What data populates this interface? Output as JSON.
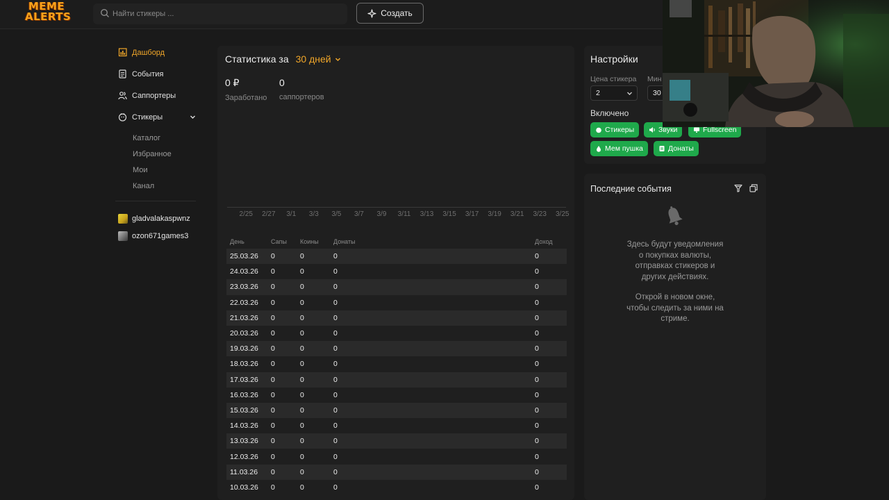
{
  "brand": {
    "logo_line1": "MEME",
    "logo_line2": "ALERTS",
    "logo_color": "#f7a21b"
  },
  "search": {
    "placeholder": "Найти стикеры ..."
  },
  "header": {
    "create_label": "Создать"
  },
  "accent": "#f0a629",
  "toggle_color": "#1fa94b",
  "sidebar": {
    "items": [
      {
        "label": "Дашборд",
        "icon": "bar-chart-icon",
        "active": true
      },
      {
        "label": "События",
        "icon": "document-icon"
      },
      {
        "label": "Саппортеры",
        "icon": "users-icon"
      },
      {
        "label": "Стикеры",
        "icon": "sticker-icon",
        "expanded": true
      }
    ],
    "sub_items": [
      "Каталог",
      "Избранное",
      "Мои",
      "Канал"
    ],
    "channels": [
      {
        "name": "gladvalakaspwnz"
      },
      {
        "name": "ozon671games3"
      }
    ]
  },
  "stats": {
    "title": "Статистика за",
    "period": "30 дней",
    "earned_value": "0 ₽",
    "earned_label": "Заработано",
    "supporters_value": "0",
    "supporters_label": "саппортеров"
  },
  "chart_data": {
    "type": "line",
    "x": [
      "2/25",
      "2/27",
      "3/1",
      "3/3",
      "3/5",
      "3/7",
      "3/9",
      "3/11",
      "3/13",
      "3/15",
      "3/17",
      "3/19",
      "3/21",
      "3/23",
      "3/25"
    ],
    "series": [
      {
        "values": [
          0,
          0,
          0,
          0,
          0,
          0,
          0,
          0,
          0,
          0,
          0,
          0,
          0,
          0,
          0
        ]
      }
    ],
    "grid": false
  },
  "table": {
    "headers": {
      "day": "День",
      "saps": "Сапы",
      "coins": "Коины",
      "donations": "Донаты",
      "income": "Доход"
    },
    "rows": [
      {
        "day": "25.03.26",
        "saps": "0",
        "coins": "0",
        "donations": "0",
        "income": "0"
      },
      {
        "day": "24.03.26",
        "saps": "0",
        "coins": "0",
        "donations": "0",
        "income": "0"
      },
      {
        "day": "23.03.26",
        "saps": "0",
        "coins": "0",
        "donations": "0",
        "income": "0"
      },
      {
        "day": "22.03.26",
        "saps": "0",
        "coins": "0",
        "donations": "0",
        "income": "0"
      },
      {
        "day": "21.03.26",
        "saps": "0",
        "coins": "0",
        "donations": "0",
        "income": "0"
      },
      {
        "day": "20.03.26",
        "saps": "0",
        "coins": "0",
        "donations": "0",
        "income": "0"
      },
      {
        "day": "19.03.26",
        "saps": "0",
        "coins": "0",
        "donations": "0",
        "income": "0"
      },
      {
        "day": "18.03.26",
        "saps": "0",
        "coins": "0",
        "donations": "0",
        "income": "0"
      },
      {
        "day": "17.03.26",
        "saps": "0",
        "coins": "0",
        "donations": "0",
        "income": "0"
      },
      {
        "day": "16.03.26",
        "saps": "0",
        "coins": "0",
        "donations": "0",
        "income": "0"
      },
      {
        "day": "15.03.26",
        "saps": "0",
        "coins": "0",
        "donations": "0",
        "income": "0"
      },
      {
        "day": "14.03.26",
        "saps": "0",
        "coins": "0",
        "donations": "0",
        "income": "0"
      },
      {
        "day": "13.03.26",
        "saps": "0",
        "coins": "0",
        "donations": "0",
        "income": "0"
      },
      {
        "day": "12.03.26",
        "saps": "0",
        "coins": "0",
        "donations": "0",
        "income": "0"
      },
      {
        "day": "11.03.26",
        "saps": "0",
        "coins": "0",
        "donations": "0",
        "income": "0"
      },
      {
        "day": "10.03.26",
        "saps": "0",
        "coins": "0",
        "donations": "0",
        "income": "0"
      }
    ]
  },
  "settings": {
    "title": "Настройки",
    "price_label": "Цена стикера",
    "price_value": "2",
    "min_label": "Мин",
    "min_value": "30",
    "enabled_label": "Включено",
    "toggles": [
      {
        "label": "Стикеры",
        "icon": "sticker-icon"
      },
      {
        "label": "Звуки",
        "icon": "speaker-icon"
      },
      {
        "label": "Fullscreen",
        "icon": "monitor-icon"
      },
      {
        "label": "Мем пушка",
        "icon": "drop-icon"
      },
      {
        "label": "Донаты",
        "icon": "wallet-icon"
      }
    ]
  },
  "events": {
    "title": "Последние события",
    "empty_line1": "Здесь будут уведомления",
    "empty_line2": "о покупках валюты,",
    "empty_line3": "отправках стикеров и",
    "empty_line4": "других действиях.",
    "hint_line1": "Открой в новом окне,",
    "hint_line2": "чтобы следить за ними на",
    "hint_line3": "стриме."
  }
}
